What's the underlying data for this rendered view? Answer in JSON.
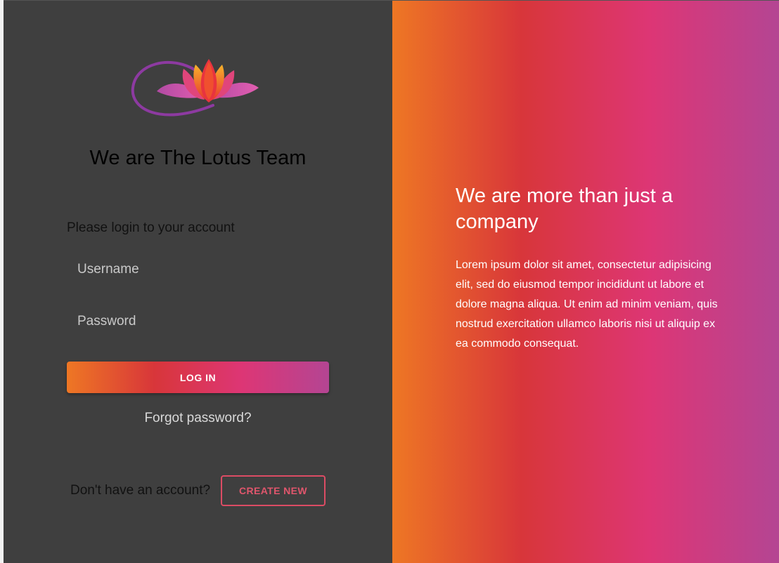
{
  "brand": {
    "title": "We are The Lotus Team",
    "logo_icon": "lotus-logo-icon"
  },
  "login_form": {
    "prompt": "Please login to your account",
    "username_placeholder": "Username",
    "password_placeholder": "Password",
    "login_label": "LOG IN",
    "forgot_label": "Forgot password?"
  },
  "signup": {
    "prompt": "Don't have an account?",
    "create_label": "CREATE NEW"
  },
  "promo": {
    "heading": "We are more than just a company",
    "body": "Lorem ipsum dolor sit amet, consectetur adipisicing elit, sed do eiusmod tempor incididunt ut labore et dolore magna aliqua. Ut enim ad minim veniam, quis nostrud exercitation ullamco laboris nisi ut aliquip ex ea commodo consequat."
  },
  "colors": {
    "panel_dark": "#3f3f3f",
    "gradient": [
      "#ee7724",
      "#d8363a",
      "#dd3675",
      "#b44593"
    ],
    "create_border": "#dc4c64"
  }
}
